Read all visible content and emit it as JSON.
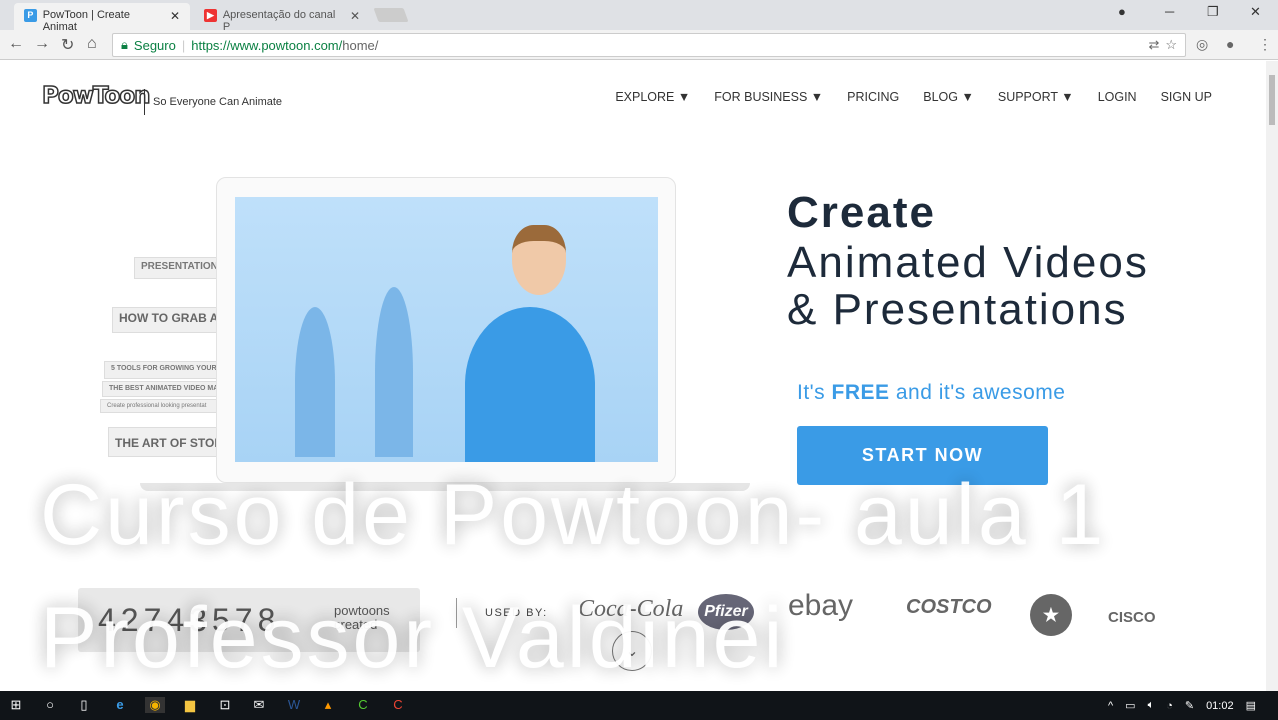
{
  "browser": {
    "tabs": [
      {
        "title": "PowToon | Create Animat",
        "favicon": "P",
        "color": "#3a9be6"
      },
      {
        "title": "Apresentação do canal P",
        "favicon": "▶",
        "color": "#e33"
      }
    ],
    "security_label": "Seguro",
    "url_host": "https://www.powtoon.com/",
    "url_path": "home/"
  },
  "site": {
    "logo": "PowToon",
    "tagline": "So Everyone Can Animate",
    "menu": [
      "EXPLORE ▼",
      "FOR BUSINESS ▼",
      "PRICING",
      "BLOG ▼",
      "SUPPORT ▼",
      "LOGIN",
      "SIGN UP"
    ],
    "books": [
      "PRESENTATION",
      "HOW TO GRAB A",
      "5 TOOLS FOR GROWING YOUR",
      "THE BEST ANIMATED VIDEO MAK",
      "Create professional looking presentat",
      "THE ART OF STORY"
    ],
    "hero_title": "Create",
    "hero_sub1": "Animated Videos",
    "hero_sub2": "& Presentations",
    "free_pre": "It's ",
    "free_bold": "FREE",
    "free_post": " and it's awesome",
    "cta": "START NOW",
    "counter": "42743578",
    "counter_label": "powtoons created",
    "used_by": "USED BY:",
    "brands": [
      "Coca-Cola",
      "Pfizer",
      "ebay",
      "COSTCO",
      "★",
      "CISCO"
    ]
  },
  "overlay": {
    "line1": "Curso de Powtoon- aula 1",
    "line2": "Professor Valdinei"
  },
  "taskbar": {
    "clock": "01:02"
  }
}
